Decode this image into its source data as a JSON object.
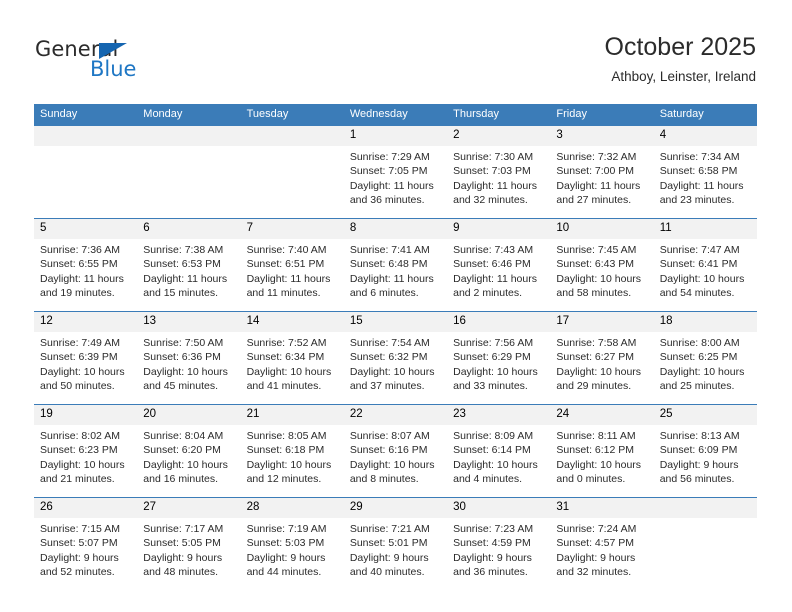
{
  "brand": {
    "name_dark": "General",
    "name_blue": "Blue",
    "accent_color": "#1f77c4",
    "triangle_color": "#1565b0"
  },
  "header": {
    "title": "October 2025",
    "subtitle": "Athboy, Leinster, Ireland"
  },
  "calendar": {
    "header_bg": "#3b7cb8",
    "daynum_bg": "#f2f2f2",
    "weekday_headers": [
      "Sunday",
      "Monday",
      "Tuesday",
      "Wednesday",
      "Thursday",
      "Friday",
      "Saturday"
    ],
    "weeks": [
      [
        {
          "day": "",
          "empty": true
        },
        {
          "day": "",
          "empty": true
        },
        {
          "day": "",
          "empty": true
        },
        {
          "day": "1",
          "sunrise": "Sunrise: 7:29 AM",
          "sunset": "Sunset: 7:05 PM",
          "daylight": "Daylight: 11 hours and 36 minutes."
        },
        {
          "day": "2",
          "sunrise": "Sunrise: 7:30 AM",
          "sunset": "Sunset: 7:03 PM",
          "daylight": "Daylight: 11 hours and 32 minutes."
        },
        {
          "day": "3",
          "sunrise": "Sunrise: 7:32 AM",
          "sunset": "Sunset: 7:00 PM",
          "daylight": "Daylight: 11 hours and 27 minutes."
        },
        {
          "day": "4",
          "sunrise": "Sunrise: 7:34 AM",
          "sunset": "Sunset: 6:58 PM",
          "daylight": "Daylight: 11 hours and 23 minutes."
        }
      ],
      [
        {
          "day": "5",
          "sunrise": "Sunrise: 7:36 AM",
          "sunset": "Sunset: 6:55 PM",
          "daylight": "Daylight: 11 hours and 19 minutes."
        },
        {
          "day": "6",
          "sunrise": "Sunrise: 7:38 AM",
          "sunset": "Sunset: 6:53 PM",
          "daylight": "Daylight: 11 hours and 15 minutes."
        },
        {
          "day": "7",
          "sunrise": "Sunrise: 7:40 AM",
          "sunset": "Sunset: 6:51 PM",
          "daylight": "Daylight: 11 hours and 11 minutes."
        },
        {
          "day": "8",
          "sunrise": "Sunrise: 7:41 AM",
          "sunset": "Sunset: 6:48 PM",
          "daylight": "Daylight: 11 hours and 6 minutes."
        },
        {
          "day": "9",
          "sunrise": "Sunrise: 7:43 AM",
          "sunset": "Sunset: 6:46 PM",
          "daylight": "Daylight: 11 hours and 2 minutes."
        },
        {
          "day": "10",
          "sunrise": "Sunrise: 7:45 AM",
          "sunset": "Sunset: 6:43 PM",
          "daylight": "Daylight: 10 hours and 58 minutes."
        },
        {
          "day": "11",
          "sunrise": "Sunrise: 7:47 AM",
          "sunset": "Sunset: 6:41 PM",
          "daylight": "Daylight: 10 hours and 54 minutes."
        }
      ],
      [
        {
          "day": "12",
          "sunrise": "Sunrise: 7:49 AM",
          "sunset": "Sunset: 6:39 PM",
          "daylight": "Daylight: 10 hours and 50 minutes."
        },
        {
          "day": "13",
          "sunrise": "Sunrise: 7:50 AM",
          "sunset": "Sunset: 6:36 PM",
          "daylight": "Daylight: 10 hours and 45 minutes."
        },
        {
          "day": "14",
          "sunrise": "Sunrise: 7:52 AM",
          "sunset": "Sunset: 6:34 PM",
          "daylight": "Daylight: 10 hours and 41 minutes."
        },
        {
          "day": "15",
          "sunrise": "Sunrise: 7:54 AM",
          "sunset": "Sunset: 6:32 PM",
          "daylight": "Daylight: 10 hours and 37 minutes."
        },
        {
          "day": "16",
          "sunrise": "Sunrise: 7:56 AM",
          "sunset": "Sunset: 6:29 PM",
          "daylight": "Daylight: 10 hours and 33 minutes."
        },
        {
          "day": "17",
          "sunrise": "Sunrise: 7:58 AM",
          "sunset": "Sunset: 6:27 PM",
          "daylight": "Daylight: 10 hours and 29 minutes."
        },
        {
          "day": "18",
          "sunrise": "Sunrise: 8:00 AM",
          "sunset": "Sunset: 6:25 PM",
          "daylight": "Daylight: 10 hours and 25 minutes."
        }
      ],
      [
        {
          "day": "19",
          "sunrise": "Sunrise: 8:02 AM",
          "sunset": "Sunset: 6:23 PM",
          "daylight": "Daylight: 10 hours and 21 minutes."
        },
        {
          "day": "20",
          "sunrise": "Sunrise: 8:04 AM",
          "sunset": "Sunset: 6:20 PM",
          "daylight": "Daylight: 10 hours and 16 minutes."
        },
        {
          "day": "21",
          "sunrise": "Sunrise: 8:05 AM",
          "sunset": "Sunset: 6:18 PM",
          "daylight": "Daylight: 10 hours and 12 minutes."
        },
        {
          "day": "22",
          "sunrise": "Sunrise: 8:07 AM",
          "sunset": "Sunset: 6:16 PM",
          "daylight": "Daylight: 10 hours and 8 minutes."
        },
        {
          "day": "23",
          "sunrise": "Sunrise: 8:09 AM",
          "sunset": "Sunset: 6:14 PM",
          "daylight": "Daylight: 10 hours and 4 minutes."
        },
        {
          "day": "24",
          "sunrise": "Sunrise: 8:11 AM",
          "sunset": "Sunset: 6:12 PM",
          "daylight": "Daylight: 10 hours and 0 minutes."
        },
        {
          "day": "25",
          "sunrise": "Sunrise: 8:13 AM",
          "sunset": "Sunset: 6:09 PM",
          "daylight": "Daylight: 9 hours and 56 minutes."
        }
      ],
      [
        {
          "day": "26",
          "sunrise": "Sunrise: 7:15 AM",
          "sunset": "Sunset: 5:07 PM",
          "daylight": "Daylight: 9 hours and 52 minutes."
        },
        {
          "day": "27",
          "sunrise": "Sunrise: 7:17 AM",
          "sunset": "Sunset: 5:05 PM",
          "daylight": "Daylight: 9 hours and 48 minutes."
        },
        {
          "day": "28",
          "sunrise": "Sunrise: 7:19 AM",
          "sunset": "Sunset: 5:03 PM",
          "daylight": "Daylight: 9 hours and 44 minutes."
        },
        {
          "day": "29",
          "sunrise": "Sunrise: 7:21 AM",
          "sunset": "Sunset: 5:01 PM",
          "daylight": "Daylight: 9 hours and 40 minutes."
        },
        {
          "day": "30",
          "sunrise": "Sunrise: 7:23 AM",
          "sunset": "Sunset: 4:59 PM",
          "daylight": "Daylight: 9 hours and 36 minutes."
        },
        {
          "day": "31",
          "sunrise": "Sunrise: 7:24 AM",
          "sunset": "Sunset: 4:57 PM",
          "daylight": "Daylight: 9 hours and 32 minutes."
        },
        {
          "day": "",
          "empty": true
        }
      ]
    ]
  }
}
